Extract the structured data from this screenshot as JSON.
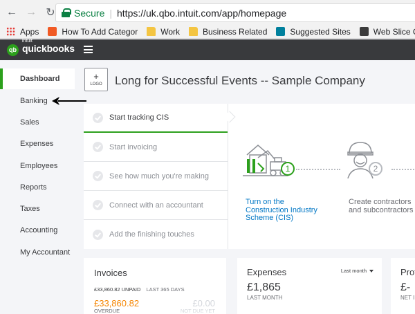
{
  "browser": {
    "secure_label": "Secure",
    "url": "https://uk.qbo.intuit.com/app/homepage",
    "bookmarks": [
      {
        "label": "Apps",
        "icon": "apps-grid-icon"
      },
      {
        "label": "How To Add Categor",
        "icon": "orange-site-icon"
      },
      {
        "label": "Work",
        "icon": "folder-icon"
      },
      {
        "label": "Business Related",
        "icon": "folder-icon"
      },
      {
        "label": "Suggested Sites",
        "icon": "bing-icon"
      },
      {
        "label": "Web Slice Gallery",
        "icon": "web-slice-icon"
      },
      {
        "label": "",
        "icon": "page-icon"
      }
    ]
  },
  "header": {
    "brand_prefix": "intuit",
    "brand": "quickbooks",
    "logo_glyph": "qb"
  },
  "sidebar": {
    "items": [
      {
        "label": "Dashboard"
      },
      {
        "label": "Banking"
      },
      {
        "label": "Sales"
      },
      {
        "label": "Expenses"
      },
      {
        "label": "Employees"
      },
      {
        "label": "Reports"
      },
      {
        "label": "Taxes"
      },
      {
        "label": "Accounting"
      },
      {
        "label": "My Accountant"
      }
    ]
  },
  "company": {
    "logo_plus": "+",
    "logo_label": "LOGO",
    "name": "Long for Successful Events -- Sample Company"
  },
  "setup": {
    "steps": [
      {
        "label": "Start tracking CIS"
      },
      {
        "label": "Start invoicing"
      },
      {
        "label": "See how much you're making"
      },
      {
        "label": "Connect with an accountant"
      },
      {
        "label": "Add the finishing touches"
      }
    ],
    "cards": [
      {
        "number": "1",
        "label": "Turn on the Construction Industry Scheme (CIS)"
      },
      {
        "number": "2",
        "label": "Create contractors and subcontractors"
      }
    ]
  },
  "invoices": {
    "title": "Invoices",
    "unpaid": "£33,860.82 UNPAID",
    "period": "LAST 365 DAYS",
    "overdue_amount": "£33,860.82",
    "overdue_label": "OVERDUE",
    "notdue_amount": "£0.00",
    "notdue_label": "NOT DUE YET"
  },
  "expenses": {
    "title": "Expenses",
    "filter": "Last month",
    "amount": "£1,865",
    "period": "LAST MONTH"
  },
  "profit": {
    "title": "Prof",
    "amount": "£-",
    "label": "NET I"
  },
  "colors": {
    "brand_green": "#2ca01c",
    "header_bg": "#393a3d",
    "link_blue": "#0077c5",
    "overdue_orange": "#f58500"
  }
}
